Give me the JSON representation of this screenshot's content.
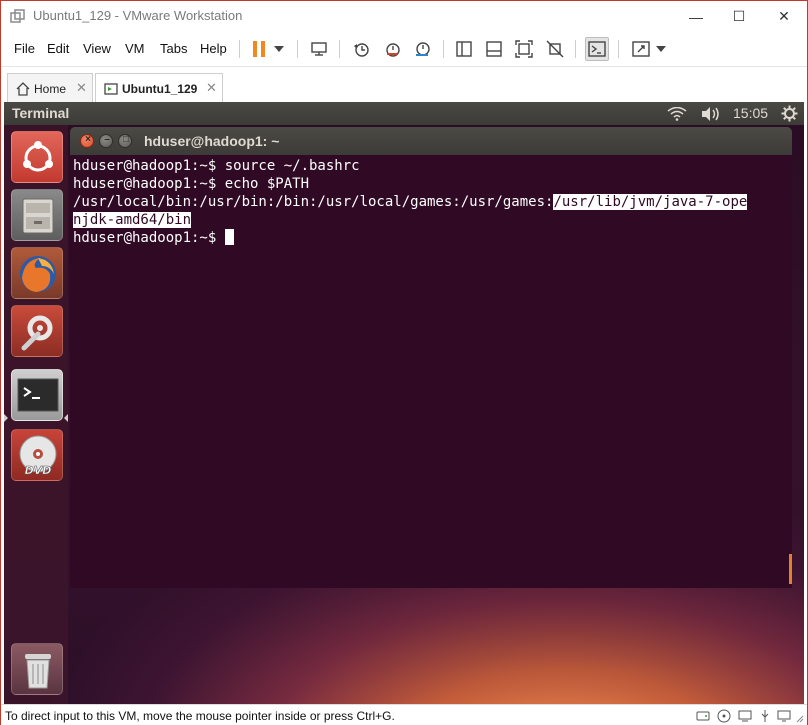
{
  "window": {
    "title": "Ubuntu1_129 - VMware Workstation",
    "minimize_glyph": "—",
    "maximize_glyph": "☐",
    "close_glyph": "✕"
  },
  "menu": {
    "items": [
      "File",
      "Edit",
      "View",
      "VM",
      "Tabs",
      "Help"
    ],
    "accent_color": "#f0891e"
  },
  "tabs": [
    {
      "label": "Home",
      "icon": "home-icon"
    },
    {
      "label": "Ubuntu1_129",
      "icon": "vm-icon",
      "active": true
    }
  ],
  "tab_close_glyph": "✕",
  "ubuntu": {
    "panel": {
      "app_title": "Terminal",
      "clock": "15:05",
      "icons": [
        "wifi-icon",
        "volume-icon",
        "gear-icon"
      ]
    },
    "launcher": [
      "ubuntu-dash-icon",
      "files-icon",
      "firefox-icon",
      "system-settings-icon",
      "terminal-icon",
      "dvd-icon",
      "trash-icon"
    ],
    "launcher_labels": {
      "dvd": "DVD"
    },
    "terminal": {
      "title": "hduser@hadoop1: ~",
      "close_glyph": "×",
      "min_glyph": "–",
      "max_glyph": "□",
      "background": "#300a24",
      "lines": [
        {
          "prompt": "hduser@hadoop1:~$ ",
          "text": "source ~/.bashrc"
        },
        {
          "prompt": "hduser@hadoop1:~$ ",
          "text": "echo $PATH"
        }
      ],
      "output_line_1": "/usr/local/bin:/usr/bin:/bin:/usr/local/games:/usr/games:",
      "output_highlight_1": "/usr/lib/jvm/java-7-ope",
      "output_highlight_2": "njdk-amd64/bin",
      "last_prompt": "hduser@hadoop1:~$ "
    }
  },
  "status": {
    "text": "To direct input to this VM, move the mouse pointer inside or press Ctrl+G."
  }
}
